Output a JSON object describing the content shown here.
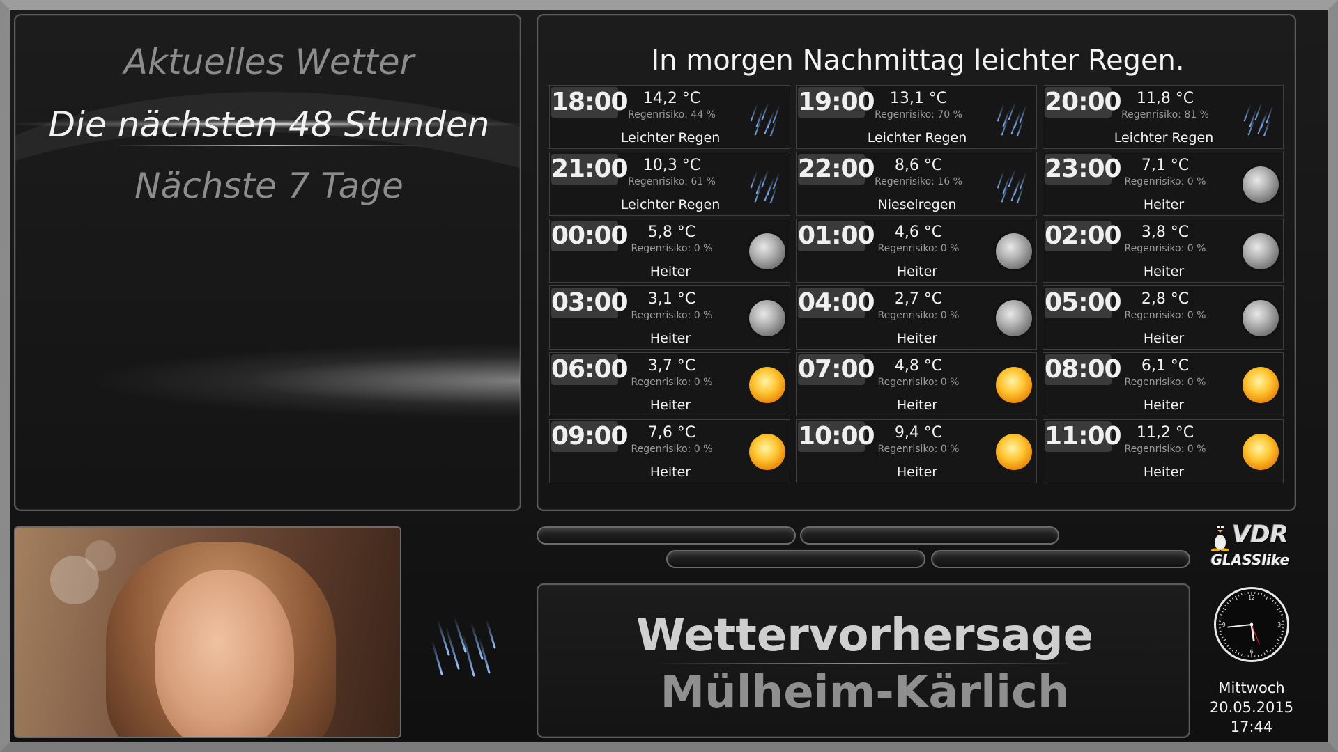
{
  "menu": {
    "items": [
      {
        "label": "Aktuelles Wetter",
        "active": false
      },
      {
        "label": "Die nächsten 48 Stunden",
        "active": true
      },
      {
        "label": "Nächste 7 Tage",
        "active": false
      }
    ]
  },
  "forecast": {
    "headline": "In morgen Nachmittag leichter Regen.",
    "entries": [
      {
        "time": "18:00",
        "temp": "14,2 °C",
        "risk": "Regenrisiko: 44 %",
        "condition": "Leichter Regen",
        "icon": "rain-icon"
      },
      {
        "time": "19:00",
        "temp": "13,1 °C",
        "risk": "Regenrisiko: 70 %",
        "condition": "Leichter Regen",
        "icon": "rain-icon"
      },
      {
        "time": "20:00",
        "temp": "11,8 °C",
        "risk": "Regenrisiko: 81 %",
        "condition": "Leichter Regen",
        "icon": "rain-icon"
      },
      {
        "time": "21:00",
        "temp": "10,3 °C",
        "risk": "Regenrisiko: 61 %",
        "condition": "Leichter Regen",
        "icon": "rain-icon"
      },
      {
        "time": "22:00",
        "temp": "8,6 °C",
        "risk": "Regenrisiko: 16 %",
        "condition": "Nieselregen",
        "icon": "rain-icon"
      },
      {
        "time": "23:00",
        "temp": "7,1 °C",
        "risk": "Regenrisiko: 0 %",
        "condition": "Heiter",
        "icon": "moon-icon"
      },
      {
        "time": "00:00",
        "temp": "5,8 °C",
        "risk": "Regenrisiko: 0 %",
        "condition": "Heiter",
        "icon": "moon-icon"
      },
      {
        "time": "01:00",
        "temp": "4,6 °C",
        "risk": "Regenrisiko: 0 %",
        "condition": "Heiter",
        "icon": "moon-icon"
      },
      {
        "time": "02:00",
        "temp": "3,8 °C",
        "risk": "Regenrisiko: 0 %",
        "condition": "Heiter",
        "icon": "moon-icon"
      },
      {
        "time": "03:00",
        "temp": "3,1 °C",
        "risk": "Regenrisiko: 0 %",
        "condition": "Heiter",
        "icon": "moon-icon"
      },
      {
        "time": "04:00",
        "temp": "2,7 °C",
        "risk": "Regenrisiko: 0 %",
        "condition": "Heiter",
        "icon": "moon-icon"
      },
      {
        "time": "05:00",
        "temp": "2,8 °C",
        "risk": "Regenrisiko: 0 %",
        "condition": "Heiter",
        "icon": "moon-icon"
      },
      {
        "time": "06:00",
        "temp": "3,7 °C",
        "risk": "Regenrisiko: 0 %",
        "condition": "Heiter",
        "icon": "sun-icon"
      },
      {
        "time": "07:00",
        "temp": "4,8 °C",
        "risk": "Regenrisiko: 0 %",
        "condition": "Heiter",
        "icon": "sun-icon"
      },
      {
        "time": "08:00",
        "temp": "6,1 °C",
        "risk": "Regenrisiko: 0 %",
        "condition": "Heiter",
        "icon": "sun-icon"
      },
      {
        "time": "09:00",
        "temp": "7,6 °C",
        "risk": "Regenrisiko: 0 %",
        "condition": "Heiter",
        "icon": "sun-icon"
      },
      {
        "time": "10:00",
        "temp": "9,4 °C",
        "risk": "Regenrisiko: 0 %",
        "condition": "Heiter",
        "icon": "sun-icon"
      },
      {
        "time": "11:00",
        "temp": "11,2 °C",
        "risk": "Regenrisiko: 0 %",
        "condition": "Heiter",
        "icon": "sun-icon"
      }
    ]
  },
  "title": {
    "app": "Wettervorhersage",
    "location": "Mülheim-Kärlich"
  },
  "logo": {
    "vdr": "VDR",
    "skin": "GLASSlike"
  },
  "clock": {
    "weekday": "Mittwoch",
    "date": "20.05.2015",
    "time": "17:44",
    "dial_numbers": [
      "12",
      "3",
      "6",
      "9"
    ]
  },
  "colors": {
    "frame": "#8a8a8a",
    "panel_border": "#5b5b5b",
    "text_active": "#f1f1f1",
    "text_inactive": "#8c8c8c",
    "sun": "#ffc531",
    "rain": "#7fb2ff"
  }
}
